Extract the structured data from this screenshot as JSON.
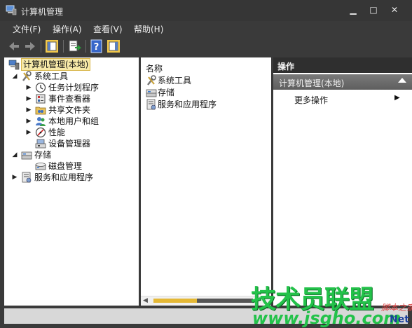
{
  "window": {
    "title": "计算机管理",
    "controls": {
      "minimize": "▁",
      "maximize": "□",
      "close": "✕"
    }
  },
  "menu": {
    "items": [
      "文件(F)",
      "操作(A)",
      "查看(V)",
      "帮助(H)"
    ]
  },
  "toolbar": {
    "icons": [
      "back-arrow-icon",
      "forward-arrow-icon",
      "show-console-tree-icon",
      "export-list-icon",
      "help-icon",
      "action-pane-icon"
    ]
  },
  "tree": {
    "root": {
      "label": "计算机管理(本地)",
      "expanded": true,
      "selected": true
    },
    "items": [
      {
        "label": "系统工具",
        "level": 1,
        "expander": "◢",
        "icon": "system-tools-icon"
      },
      {
        "label": "任务计划程序",
        "level": 2,
        "expander": "▶",
        "icon": "task-scheduler-icon"
      },
      {
        "label": "事件查看器",
        "level": 2,
        "expander": "▶",
        "icon": "event-viewer-icon"
      },
      {
        "label": "共享文件夹",
        "level": 2,
        "expander": "▶",
        "icon": "shared-folders-icon"
      },
      {
        "label": "本地用户和组",
        "level": 2,
        "expander": "▶",
        "icon": "local-users-icon"
      },
      {
        "label": "性能",
        "level": 2,
        "expander": "▶",
        "icon": "performance-icon"
      },
      {
        "label": "设备管理器",
        "level": 2,
        "expander": "",
        "icon": "device-manager-icon"
      },
      {
        "label": "存储",
        "level": 1,
        "expander": "◢",
        "icon": "storage-icon"
      },
      {
        "label": "磁盘管理",
        "level": 2,
        "expander": "",
        "icon": "disk-management-icon"
      },
      {
        "label": "服务和应用程序",
        "level": 1,
        "expander": "▶",
        "icon": "services-apps-icon"
      }
    ]
  },
  "list": {
    "header": "名称",
    "rows": [
      {
        "label": "系统工具",
        "icon": "system-tools-icon"
      },
      {
        "label": "存储",
        "icon": "storage-icon"
      },
      {
        "label": "服务和应用程序",
        "icon": "services-apps-icon"
      }
    ]
  },
  "actions": {
    "header": "操作",
    "section": "计算机管理(本地)",
    "item": "更多操作",
    "item_arrow": "▶"
  },
  "watermark": {
    "main": "技术员联盟",
    "url": "www.jsgho.com",
    "site": "脚本之家",
    "net": "Net"
  },
  "colors": {
    "selection_bg": "#f7e9a8",
    "scroll_thumb": "#e4b835",
    "watermark_green": "#23c24a"
  }
}
